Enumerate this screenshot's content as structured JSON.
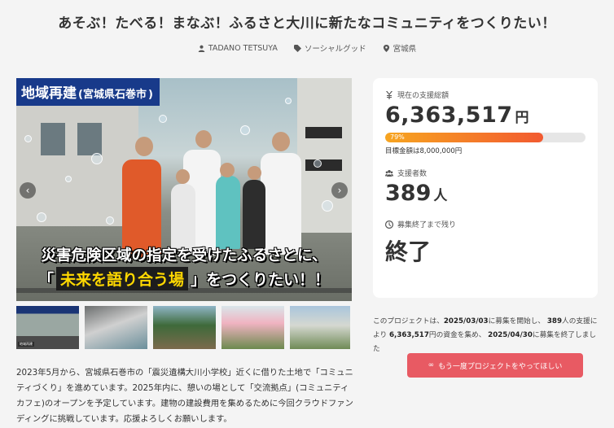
{
  "project": {
    "title": "あそぶ！たべる！まなぶ！ふるさと大川に新たなコミュニティをつくりたい！",
    "author": "TADANO TETSUYA",
    "category": "ソーシャルグッド",
    "location": "宮城県"
  },
  "hero": {
    "tag_main": "地域再建",
    "tag_sub": "(宮城県石巻市",
    "tag_close": ")",
    "line1": "災害危険区域の指定を受けたふるさとに、",
    "line2_open": "「",
    "line2_highlight": "未来を語り合う場",
    "line2_rest": "」をつくりたい！！"
  },
  "thumbnails": [
    {
      "caption": "地域再建"
    },
    {
      "caption": ""
    },
    {
      "caption": ""
    },
    {
      "caption": ""
    },
    {
      "caption": ""
    }
  ],
  "description": "2023年5月から、宮城県石巻市の「震災遺構大川小学校」近くに借りた土地で「コミュニティづくり」を進めています。2025年内に、憩いの場として「交流拠点」(コミュニティカフェ)のオープンを予定しています。建物の建設費用を集めるために今回クラウドファンディングに挑戦しています。応援よろしくお願いします。",
  "stats": {
    "total_label": "現在の支援総額",
    "total_amount": "6,363,517",
    "total_unit": "円",
    "progress_label": "79%",
    "progress_value": 0.79,
    "goal_text": "目標金額は8,000,000円",
    "supporters_label": "支援者数",
    "supporters_count": "389",
    "supporters_unit": "人",
    "remaining_label": "募集終了まで残り",
    "remaining_value": "終了"
  },
  "result": {
    "p1": "このプロジェクトは、",
    "start": "2025/03/03",
    "p2": "に募集を開始し、",
    "backers": "389",
    "p3": "人の支援により",
    "amount": "6,363,517",
    "p4": "円の資金を集め、",
    "end": "2025/04/30",
    "p5": "に募集を終了しました"
  },
  "cta_label": "もう一度プロジェクトをやってほしい",
  "colors": {
    "accent": "#e85a63",
    "progress_start": "#f7a520",
    "progress_end": "#f25a30",
    "hero_tag": "#183a8a",
    "highlight": "#ffd800"
  }
}
